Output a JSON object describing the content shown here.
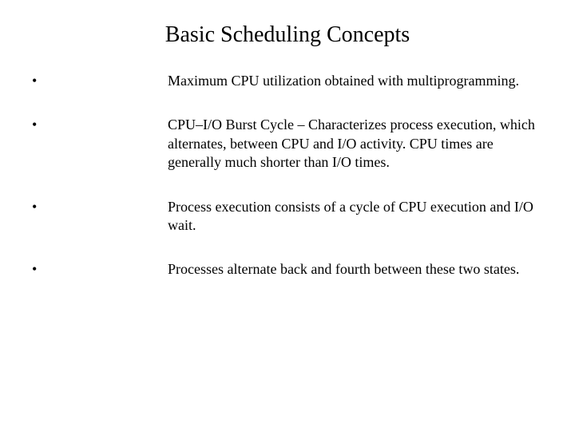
{
  "title": "Basic Scheduling Concepts",
  "bullets": [
    {
      "marker": "•",
      "text": " Maximum CPU utilization obtained with multiprogramming."
    },
    {
      "marker": "•",
      "text": " CPU–I/O Burst Cycle – Characterizes process execution, which   alternates, between CPU and I/O activity.  CPU times are generally much shorter than I/O times."
    },
    {
      "marker": "•",
      "text": " Process execution consists of a cycle of CPU execution and I/O wait."
    },
    {
      "marker": "•",
      "text": " Processes alternate back and fourth between these two states."
    }
  ]
}
